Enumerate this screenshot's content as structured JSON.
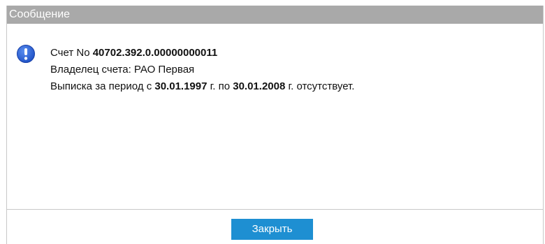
{
  "dialog": {
    "title": "Сообщение",
    "icon": "info-icon",
    "accent_color": "#1e8fd2",
    "message": {
      "line1_prefix": "Счет No ",
      "account_number": "40702.392.0.00000000011",
      "line2": "Владелец счета: РАО Первая",
      "line3_prefix": "Выписка за период с ",
      "date_from": "30.01.1997",
      "line3_middle": " г. по ",
      "date_to": "30.01.2008",
      "line3_suffix": " г. отсутствует."
    },
    "close_label": "Закрыть"
  }
}
